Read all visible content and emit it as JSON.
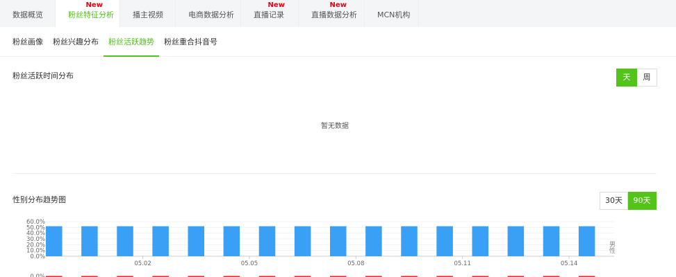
{
  "top_tabs": [
    {
      "label": "数据概览",
      "new": ""
    },
    {
      "label": "粉丝特征分析",
      "new": "New"
    },
    {
      "label": "播主视频",
      "new": ""
    },
    {
      "label": "电商数据分析",
      "new": ""
    },
    {
      "label": "直播记录",
      "new": "New"
    },
    {
      "label": "直播数据分析",
      "new": "New"
    },
    {
      "label": "MCN机构",
      "new": ""
    }
  ],
  "sub_tabs": [
    {
      "label": "粉丝画像"
    },
    {
      "label": "粉丝兴趣分布"
    },
    {
      "label": "粉丝活跃趋势"
    },
    {
      "label": "粉丝重合抖音号"
    }
  ],
  "activity_section": {
    "title": "粉丝活跃时间分布",
    "toggle": {
      "day_label": "天",
      "week_label": "周",
      "selected": "天"
    },
    "empty_text": "暂无数据"
  },
  "gender_section": {
    "title": "性别分布趋势图",
    "toggle": {
      "d30_label": "30天",
      "d90_label": "90天",
      "selected": "90天"
    },
    "legend_label": "男性"
  },
  "colors": {
    "accent": "#52c41a",
    "bar": "#3aa0f6",
    "new_badge": "#e60012",
    "red_series": "#f5222d"
  },
  "chart_data": {
    "type": "bar",
    "yticks": [
      "60.0%",
      "50.0%",
      "40.0%",
      "30.0%",
      "20.0%",
      "10.0%",
      "0.0%"
    ],
    "ylim": [
      0,
      60
    ],
    "x_labels": [
      "05.02",
      "05.05",
      "05.08",
      "05.11",
      "05.14"
    ],
    "series": [
      {
        "name": "男性",
        "values": [
          52,
          52,
          52,
          52,
          52,
          52,
          52,
          52,
          52,
          52,
          52,
          52,
          52,
          52,
          52,
          52
        ]
      }
    ],
    "second_chart_top_tick": "0.0%"
  }
}
